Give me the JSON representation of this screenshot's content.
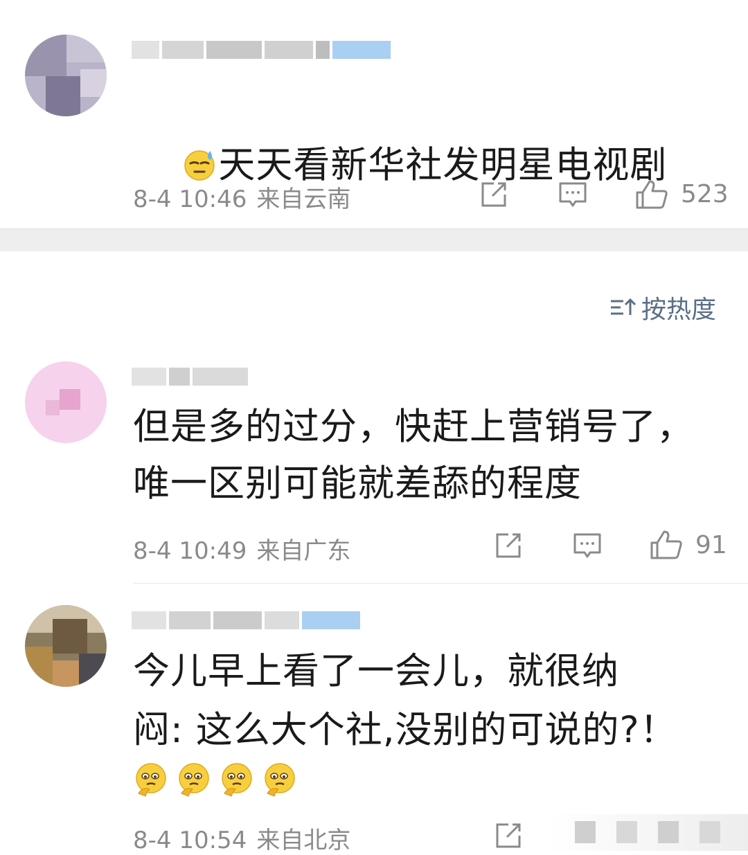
{
  "comments": [
    {
      "text": "天天看新华社发明星电视剧",
      "time": "8-4 10:46",
      "location": "来自云南",
      "likes": "523",
      "leading_emoji": "sweat-face-icon"
    },
    {
      "text_lines": [
        "但是多的过分，快赶上营销号了，",
        "唯一区别可能就差舔的程度"
      ],
      "time": "8-4 10:49",
      "location": "来自广东",
      "likes": "91"
    },
    {
      "text_lines": [
        "今儿早上看了一会儿，就很纳",
        "闷: 这么大个社,没别的可说的?！"
      ],
      "trailing_emojis": [
        "thinking-face-icon",
        "thinking-face-icon",
        "thinking-face-icon",
        "thinking-face-icon"
      ],
      "time": "8-4 10:54",
      "location": "来自北京"
    }
  ],
  "sort": {
    "label": "按热度"
  },
  "colors": {
    "divider_band": "#eeeeee",
    "text": "#1a1a1a",
    "meta": "#8a8a8a",
    "sort_accent": "#5a6f86",
    "blur_blue": "#a9cff2"
  }
}
